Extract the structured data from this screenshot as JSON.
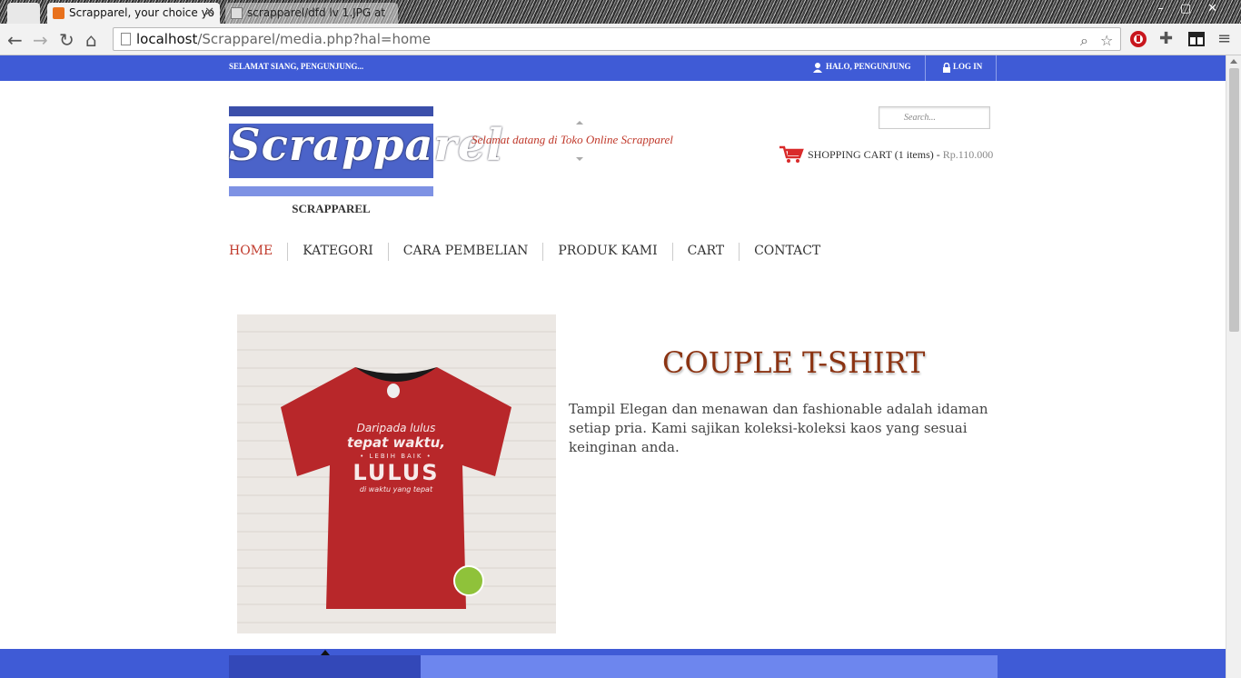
{
  "browser": {
    "tabs": [
      {
        "label": ""
      },
      {
        "label": "Scrapparel, your choice yo"
      },
      {
        "label": "scrapparel/dfd lv 1.JPG at"
      }
    ],
    "url_host": "localhost",
    "url_path": "/Scrapparel/media.php?hal=home"
  },
  "topbar": {
    "greeting": "SELAMAT SIANG, PENGUNJUNG...",
    "user_text": "HALO,  PENGUNJUNG",
    "login_label": "LOG IN"
  },
  "header": {
    "logo_text": "Scrapparel",
    "site_name": "SCRAPPAREL",
    "welcome": "Selamat datang di Toko Online Scrapparel",
    "search_placeholder": "Search...",
    "cart_label": "SHOPPING CART (1 items) - ",
    "cart_price": "Rp.110.000"
  },
  "nav": {
    "items": [
      {
        "label": "HOME"
      },
      {
        "label": "KATEGORI"
      },
      {
        "label": "CARA PEMBELIAN"
      },
      {
        "label": "PRODUK KAMI"
      },
      {
        "label": "CART"
      },
      {
        "label": "CONTACT"
      }
    ]
  },
  "product": {
    "title": "COUPLE T-SHIRT",
    "description": "Tampil Elegan dan menawan dan fashionable adalah idaman setiap pria. Kami sajikan koleksi-koleksi kaos yang sesuai keinginan anda.",
    "shirt_lines": [
      "Daripada lulus",
      "tepat waktu,",
      "• LEBIH BAIK •",
      "LULUS",
      "di waktu yang tepat"
    ]
  },
  "colors": {
    "brand_blue": "#3f5bd6",
    "accent_red": "#c0392b",
    "title_brown": "#8b3312",
    "shirt_red": "#b8272a"
  }
}
